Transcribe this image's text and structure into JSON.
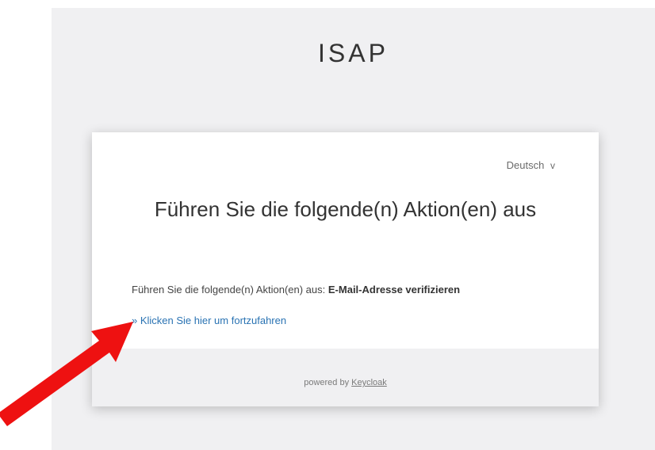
{
  "app": {
    "title": "ISAP"
  },
  "language": {
    "selected": "Deutsch",
    "chevron": "v"
  },
  "card": {
    "heading": "Führen Sie die folgende(n) Aktion(en) aus",
    "instruction_prefix": "Führen Sie die folgende(n) Aktion(en) aus:",
    "instruction_action": "E-Mail-Adresse verifizieren",
    "continue_link": "» Klicken Sie hier um fortzufahren"
  },
  "footer": {
    "powered_prefix": "powered by",
    "powered_link": "Keycloak"
  },
  "annotation": {
    "arrow_color": "#ee1111",
    "arrow_target": "continue-link"
  },
  "colors": {
    "page_background": "#f0f0f2",
    "link": "#2a73b3"
  }
}
